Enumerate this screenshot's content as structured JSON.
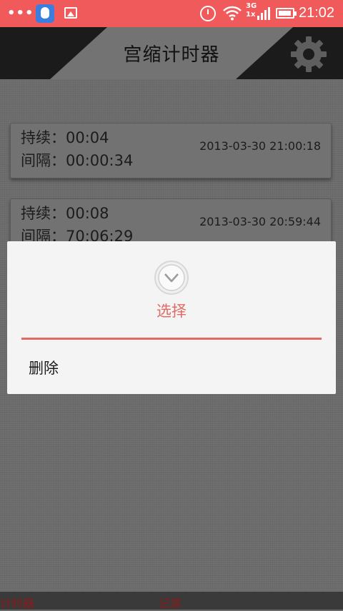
{
  "status_bar": {
    "time": "21:02",
    "network_top": "3G",
    "network_bottom": "1x"
  },
  "header": {
    "title": "宫缩计时器"
  },
  "records": [
    {
      "duration_label": "持续：",
      "duration": "00:04",
      "interval_label": "间隔：",
      "interval": "00:00:34",
      "timestamp": "2013-03-30 21:00:18"
    },
    {
      "duration_label": "持续：",
      "duration": "00:08",
      "interval_label": "间隔：",
      "interval": "70:06:29",
      "timestamp": "2013-03-30 20:59:44"
    }
  ],
  "dialog": {
    "title": "选择",
    "items": [
      "删除"
    ]
  },
  "tabs": [
    "计时器",
    "记录"
  ],
  "colors": {
    "status_bar": "#f05a5a",
    "accent": "#e06a66",
    "tab_text": "#8b1a1a"
  }
}
